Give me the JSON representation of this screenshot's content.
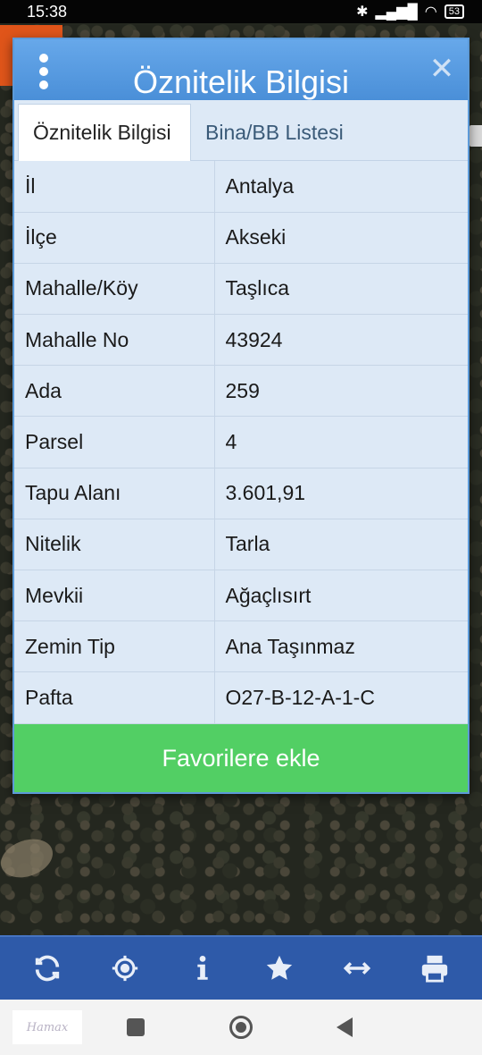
{
  "status_bar": {
    "time": "15:38",
    "battery": "53"
  },
  "dialog": {
    "title": "Öznitelik Bilgisi",
    "close_label": "✕",
    "tabs": [
      {
        "label": "Öznitelik Bilgisi",
        "active": true
      },
      {
        "label": "Bina/BB Listesi",
        "active": false
      }
    ],
    "rows": [
      {
        "key": "İl",
        "value": "Antalya"
      },
      {
        "key": "İlçe",
        "value": "Akseki"
      },
      {
        "key": "Mahalle/Köy",
        "value": "Taşlıca"
      },
      {
        "key": "Mahalle No",
        "value": "43924"
      },
      {
        "key": "Ada",
        "value": "259"
      },
      {
        "key": "Parsel",
        "value": "4"
      },
      {
        "key": "Tapu Alanı",
        "value": "3.601,91"
      },
      {
        "key": "Nitelik",
        "value": "Tarla"
      },
      {
        "key": "Mevkii",
        "value": "Ağaçlısırt"
      },
      {
        "key": "Zemin Tip",
        "value": "Ana Taşınmaz"
      },
      {
        "key": "Pafta",
        "value": "O27-B-12-A-1-C"
      }
    ],
    "favorite_button": "Favorilere ekle"
  },
  "toolbar": {
    "items": [
      {
        "name": "refresh-icon"
      },
      {
        "name": "locate-icon"
      },
      {
        "name": "info-icon"
      },
      {
        "name": "star-icon"
      },
      {
        "name": "measure-icon"
      },
      {
        "name": "print-icon"
      }
    ]
  },
  "navbar": {
    "logo_text": "Hamax"
  },
  "colors": {
    "header_blue": "#4a8fd8",
    "dialog_bg": "#dde9f6",
    "favorite_green": "#52cf64",
    "toolbar_blue": "#2e5aa9"
  }
}
